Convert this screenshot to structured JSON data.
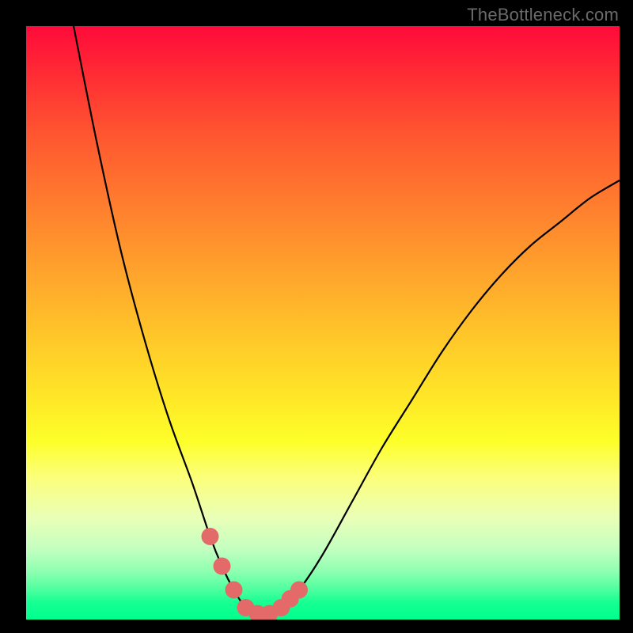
{
  "watermark": "TheBottleneck.com",
  "chart_data": {
    "type": "line",
    "title": "",
    "xlabel": "",
    "ylabel": "",
    "xlim": [
      0,
      100
    ],
    "ylim": [
      0,
      100
    ],
    "series": [
      {
        "name": "bottleneck-curve",
        "x": [
          8,
          12,
          16,
          20,
          24,
          28,
          31,
          33,
          35,
          37,
          39,
          41,
          43,
          46,
          50,
          55,
          60,
          65,
          70,
          75,
          80,
          85,
          90,
          95,
          100
        ],
        "values": [
          100,
          80,
          62,
          47,
          34,
          23,
          14,
          9,
          5,
          2,
          1,
          1,
          2,
          5,
          11,
          20,
          29,
          37,
          45,
          52,
          58,
          63,
          67,
          71,
          74
        ]
      }
    ],
    "markers": {
      "name": "highlight-points",
      "x": [
        31,
        33,
        35,
        37,
        39,
        41,
        43,
        44.5,
        46
      ],
      "values": [
        14,
        9,
        5,
        2,
        1,
        1,
        2,
        3.5,
        5
      ]
    },
    "gradient_background": {
      "description": "vertical heatmap gradient from red (top) through yellow to green (bottom)",
      "stops": [
        {
          "pos": 0.0,
          "color": "#ff0a3a"
        },
        {
          "pos": 0.3,
          "color": "#ff7d2e"
        },
        {
          "pos": 0.6,
          "color": "#ffe827"
        },
        {
          "pos": 0.82,
          "color": "#e9ffb8"
        },
        {
          "pos": 1.0,
          "color": "#00ff8e"
        }
      ]
    },
    "colors": {
      "curve": "#000000",
      "marker_fill": "#e46a69",
      "marker_stroke": "#e46a69",
      "background_frame": "#000000"
    }
  }
}
